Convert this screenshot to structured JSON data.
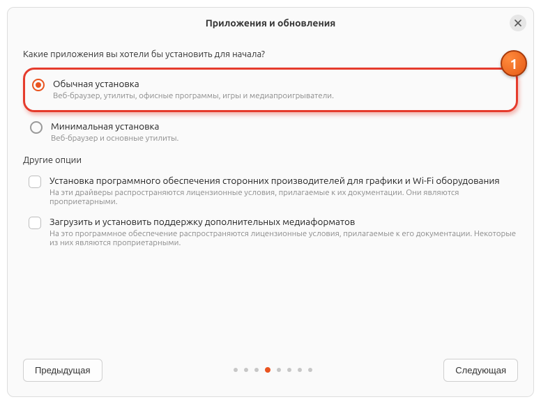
{
  "header": {
    "title": "Приложения и обновления"
  },
  "question": "Какие приложения вы хотели бы установить для начала?",
  "highlight_badge": "1",
  "options": {
    "default": {
      "title": "Обычная установка",
      "desc": "Веб-браузер, утилиты, офисные программы, игры и медиапроигрыватели."
    },
    "minimal": {
      "title": "Минимальная установка",
      "desc": "Веб-браузер и основные утилиты."
    }
  },
  "other_label": "Другие опции",
  "checks": {
    "thirdparty": {
      "title": "Установка программного обеспечения сторонних производителей для графики и Wi-Fi оборудования",
      "desc": "На эти драйверы распространяются лицензионные условия, прилагаемые к их документации. Они являются проприетарными."
    },
    "media": {
      "title": "Загрузить и установить поддержку дополнительных медиаформатов",
      "desc": "На это программное обеспечение распространяются лицензионные условия, прилагаемые к его документации. Некоторые из них являются проприетарными."
    }
  },
  "footer": {
    "prev": "Предыдущая",
    "next": "Следующая"
  },
  "progress": {
    "total": 8,
    "current": 4
  }
}
